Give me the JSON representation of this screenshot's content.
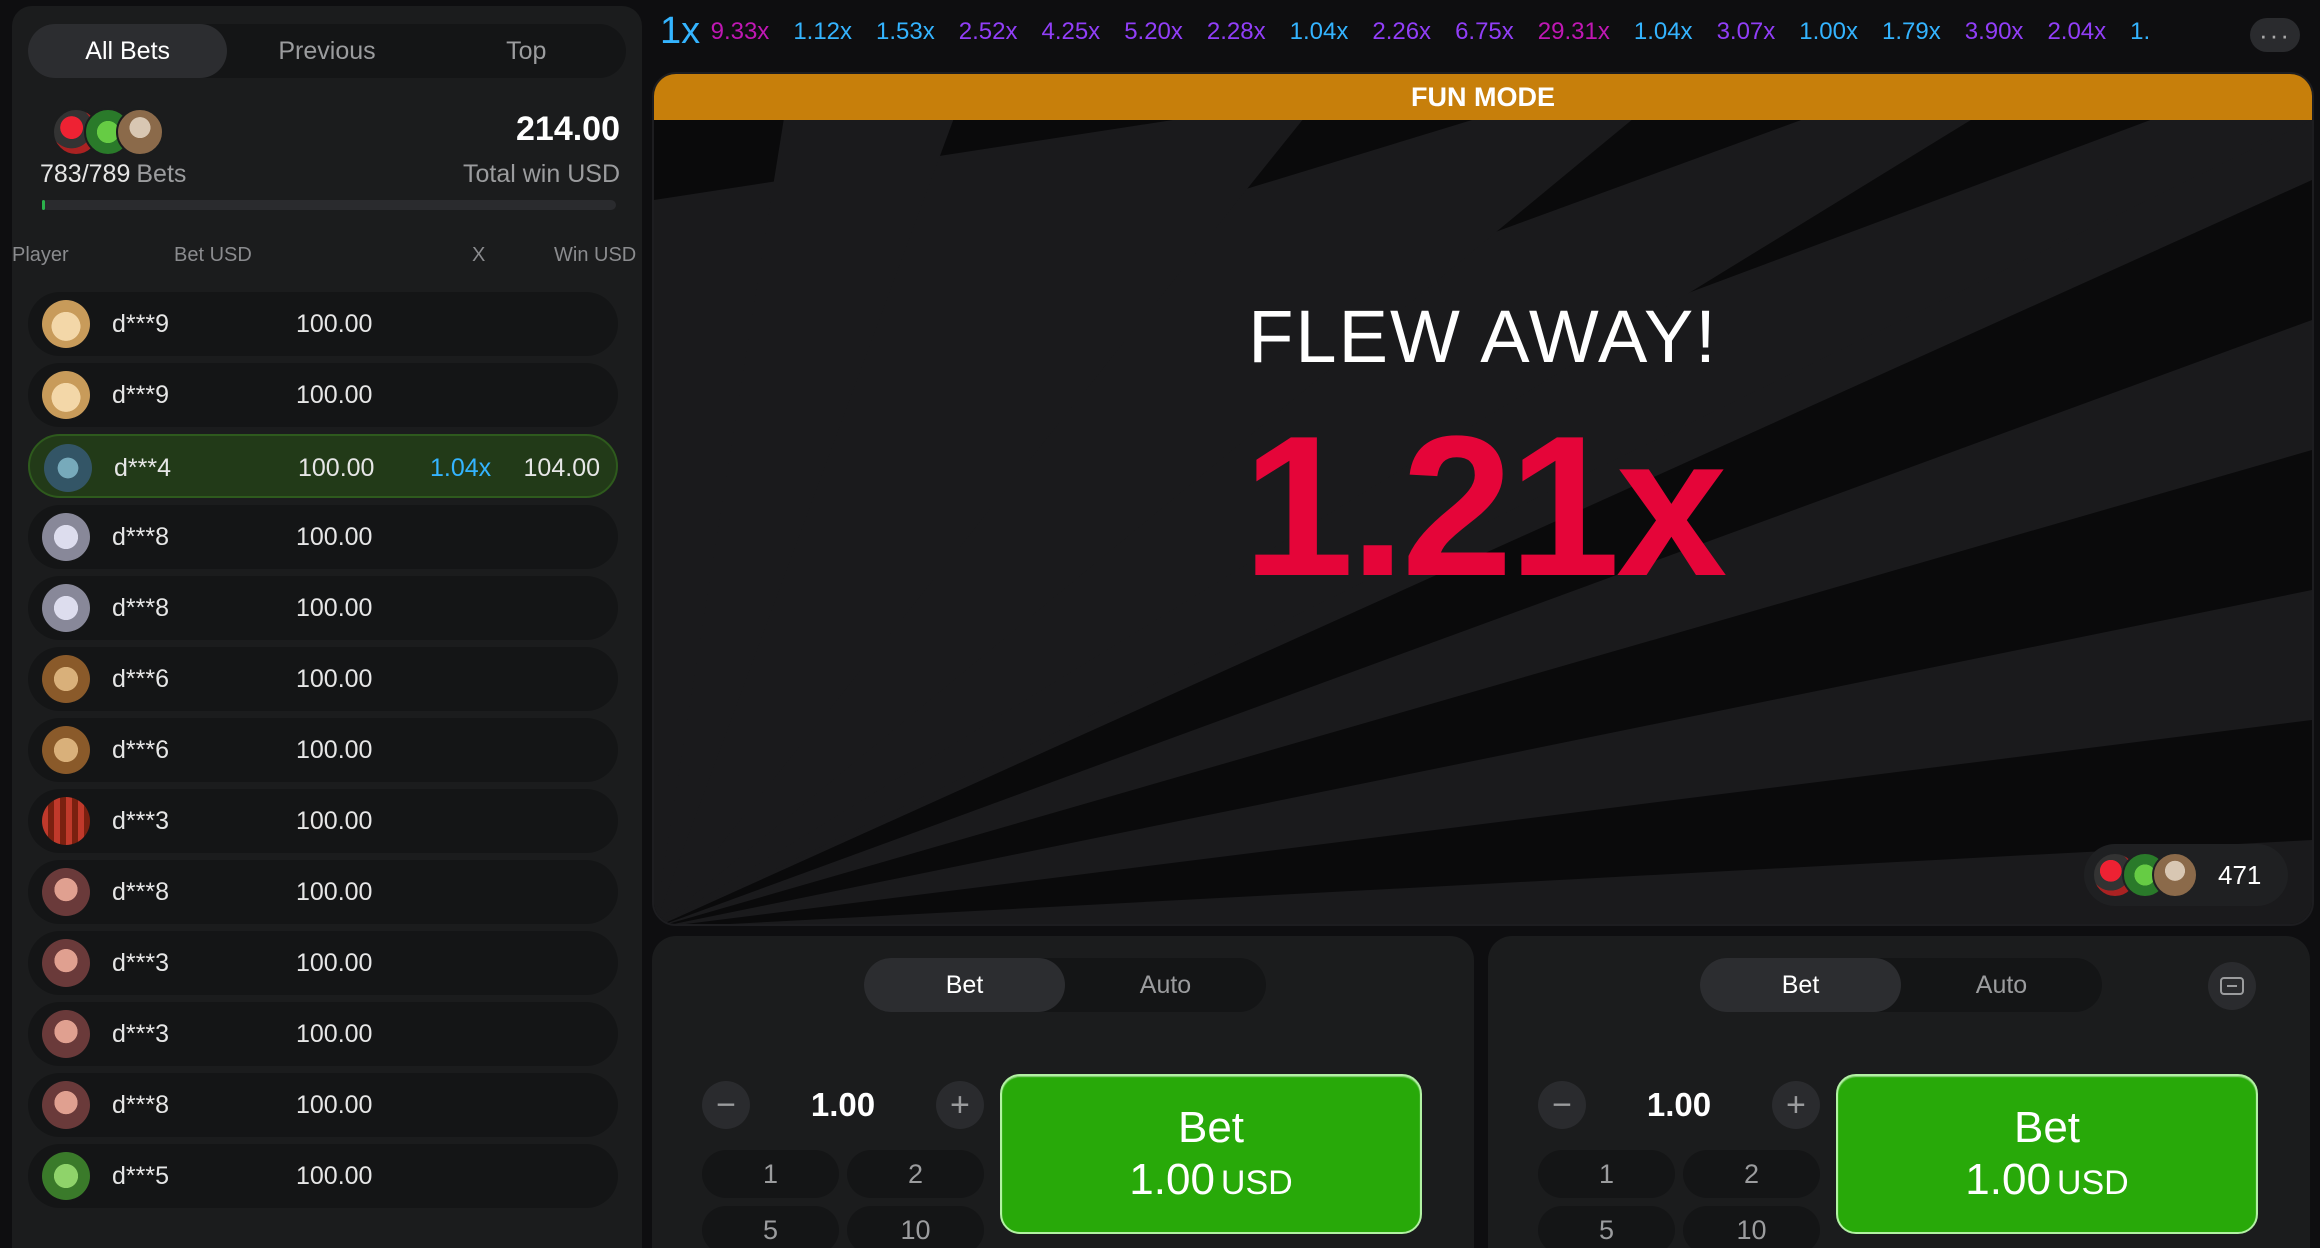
{
  "left_panel": {
    "tabs": [
      "All Bets",
      "Previous",
      "Top"
    ],
    "bets_count": "783/789",
    "bets_label": "Bets",
    "total_win": "214.00",
    "total_win_label": "Total win USD",
    "progress_fraction": 0.006,
    "columns": {
      "player": "Player",
      "bet": "Bet USD",
      "x": "X",
      "win": "Win USD"
    },
    "rows": [
      {
        "player": "d***9",
        "bet": "100.00",
        "x": "",
        "win": ""
      },
      {
        "player": "d***9",
        "bet": "100.00",
        "x": "",
        "win": ""
      },
      {
        "player": "d***4",
        "bet": "100.00",
        "x": "1.04x",
        "win": "104.00"
      },
      {
        "player": "d***8",
        "bet": "100.00",
        "x": "",
        "win": ""
      },
      {
        "player": "d***8",
        "bet": "100.00",
        "x": "",
        "win": ""
      },
      {
        "player": "d***6",
        "bet": "100.00",
        "x": "",
        "win": ""
      },
      {
        "player": "d***6",
        "bet": "100.00",
        "x": "",
        "win": ""
      },
      {
        "player": "d***3",
        "bet": "100.00",
        "x": "",
        "win": ""
      },
      {
        "player": "d***8",
        "bet": "100.00",
        "x": "",
        "win": ""
      },
      {
        "player": "d***3",
        "bet": "100.00",
        "x": "",
        "win": ""
      },
      {
        "player": "d***3",
        "bet": "100.00",
        "x": "",
        "win": ""
      },
      {
        "player": "d***8",
        "bet": "100.00",
        "x": "",
        "win": ""
      },
      {
        "player": "d***5",
        "bet": "100.00",
        "x": "",
        "win": ""
      }
    ]
  },
  "history": {
    "first": "1x",
    "items": [
      {
        "v": "9.33x",
        "c": "#c017b4"
      },
      {
        "v": "1.12x",
        "c": "#34b4ff"
      },
      {
        "v": "1.53x",
        "c": "#34b4ff"
      },
      {
        "v": "2.52x",
        "c": "#913ef8"
      },
      {
        "v": "4.25x",
        "c": "#913ef8"
      },
      {
        "v": "5.20x",
        "c": "#913ef8"
      },
      {
        "v": "2.28x",
        "c": "#913ef8"
      },
      {
        "v": "1.04x",
        "c": "#34b4ff"
      },
      {
        "v": "2.26x",
        "c": "#913ef8"
      },
      {
        "v": "6.75x",
        "c": "#913ef8"
      },
      {
        "v": "29.31x",
        "c": "#c017b4"
      },
      {
        "v": "1.04x",
        "c": "#34b4ff"
      },
      {
        "v": "3.07x",
        "c": "#913ef8"
      },
      {
        "v": "1.00x",
        "c": "#34b4ff"
      },
      {
        "v": "1.79x",
        "c": "#34b4ff"
      },
      {
        "v": "3.90x",
        "c": "#913ef8"
      },
      {
        "v": "2.04x",
        "c": "#913ef8"
      },
      {
        "v": "1.",
        "c": "#34b4ff"
      }
    ],
    "menu_label": "···"
  },
  "game": {
    "banner": "FUN MODE",
    "status": "FLEW AWAY!",
    "multiplier": "1.21x",
    "online_count": "471"
  },
  "bet_panels": [
    {
      "tabs": [
        "Bet",
        "Auto"
      ],
      "amount": "1.00",
      "quick": [
        "1",
        "2",
        "5",
        "10"
      ],
      "button_label": "Bet",
      "button_amount": "1.00",
      "currency": "USD"
    },
    {
      "tabs": [
        "Bet",
        "Auto"
      ],
      "amount": "1.00",
      "quick": [
        "1",
        "2",
        "5",
        "10"
      ],
      "button_label": "Bet",
      "button_amount": "1.00",
      "currency": "USD"
    }
  ],
  "colors": {
    "accent_blue": "#34b4ff",
    "purple": "#913ef8",
    "magenta": "#c017b4",
    "crash_red": "#e50539",
    "bet_green": "#28a909",
    "banner_orange": "#c77f0b"
  }
}
